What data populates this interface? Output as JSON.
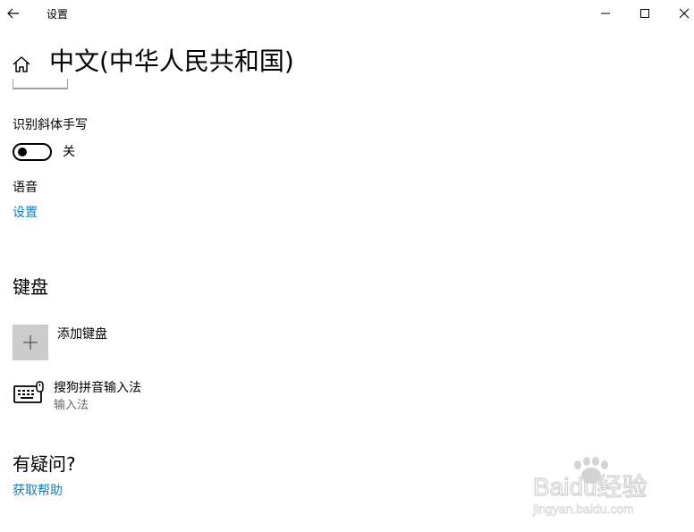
{
  "window": {
    "title": "设置"
  },
  "header": {
    "page_title": "中文(中华人民共和国)"
  },
  "handwriting": {
    "label": "识别斜体手写",
    "toggle_state": "关"
  },
  "speech": {
    "label": "语音",
    "settings_link": "设置"
  },
  "keyboard": {
    "section_title": "键盘",
    "add_label": "添加键盘",
    "items": [
      {
        "name": "搜狗拼音输入法",
        "type": "输入法"
      }
    ]
  },
  "help": {
    "section_title": "有疑问?",
    "link": "获取帮助"
  },
  "watermark": {
    "brand": "Baidu经验",
    "url": "jingyan.baidu.com"
  },
  "colors": {
    "link": "#1a7bb8",
    "tile": "#cccccc",
    "secondary_text": "#666666"
  }
}
